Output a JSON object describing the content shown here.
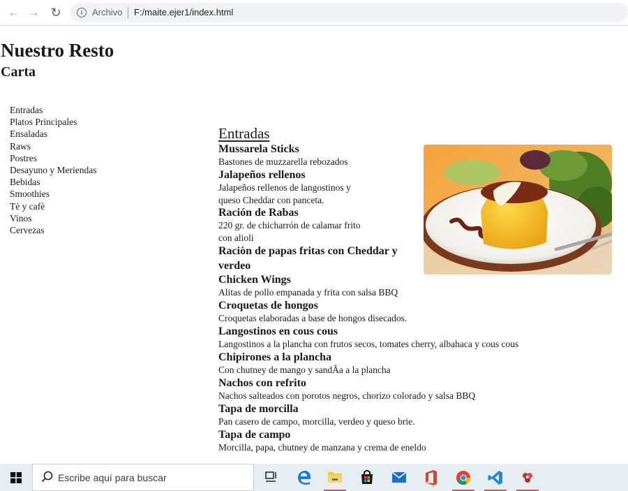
{
  "browser": {
    "scheme_label": "Archivo",
    "url": "F:/maite.ejer1/index.html",
    "back_icon": "back-arrow-icon",
    "forward_icon": "forward-arrow-icon",
    "reload_icon": "reload-icon",
    "info_icon": "info-icon"
  },
  "page": {
    "title": "Nuestro Resto",
    "subtitle": "Carta"
  },
  "nav": [
    "Entradas",
    "Platos Principales",
    "Ensaladas",
    "Raws",
    "Postres",
    "Desayuno y Meriendas",
    "Bebidas",
    "Smoothies",
    "Tè y cafè",
    "Vinos",
    "Cervezas"
  ],
  "section": {
    "title": "Entradas",
    "items": [
      {
        "name": "Mussarela Sticks",
        "desc": "Bastones de muzzarella rebozados"
      },
      {
        "name": "Jalapeños rellenos",
        "desc": "Jalapeños rellenos de langostinos y queso Cheddar con panceta."
      },
      {
        "name": "Ración de Rabas",
        "desc": "220 gr. de chicharrón de calamar frito con alioli"
      },
      {
        "name": "Raciòn de papas fritas con Cheddar y verdeo",
        "desc": ""
      },
      {
        "name": "Chicken Wings",
        "desc": "Alitas de pollo empanada y frita con salsa BBQ"
      },
      {
        "name": "Croquetas de hongos",
        "desc": "Croquetas elaboradas a base de hongos disecados."
      },
      {
        "name": "Langostinos en cous cous",
        "desc": "Langostinos a la plancha con frutos secos, tomates cherry, albahaca y cous cous"
      },
      {
        "name": "Chipirones a la plancha",
        "desc": "Con chutney de mango y sandÃa a la plancha"
      },
      {
        "name": "Nachos con refrito",
        "desc": "Nachos salteados con porotos negros, chorizo colorado y salsa BBQ"
      },
      {
        "name": "Tapa de morcilla",
        "desc": "Pan casero de campo, morcilla, verdeo y queso brie."
      },
      {
        "name": "Tapa de campo",
        "desc": "Morcilla, papa, chutney de manzana y crema de eneldo"
      }
    ]
  },
  "taskbar": {
    "search_placeholder": "Escribe aquí para buscar",
    "icons": [
      "windows-start-icon",
      "task-view-icon",
      "edge-icon",
      "file-explorer-icon",
      "store-icon",
      "mail-icon",
      "office-icon",
      "chrome-icon",
      "vscode-icon",
      "app-icon"
    ]
  },
  "colors": {
    "taskbar": "#e6edf3",
    "omnibox": "#f1f3f4",
    "underline": "#1a1a9a"
  }
}
